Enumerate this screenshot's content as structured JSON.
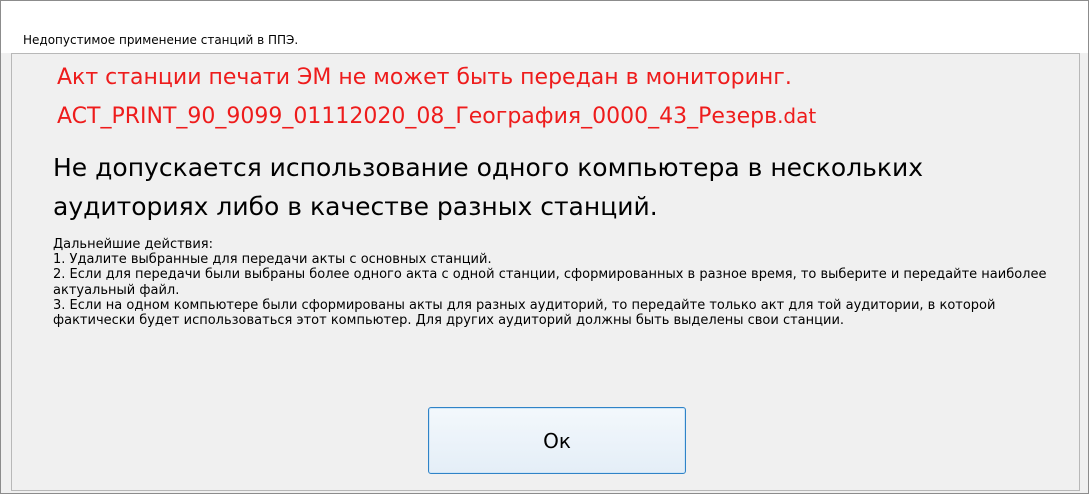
{
  "window": {
    "title": "Недопустимое применение станций в ППЭ."
  },
  "error": {
    "line1": "Акт станции печати ЭМ не может быть передан в мониторинг.",
    "file_name": "ACT_PRINT_90_9099_01112020_08_География_0000_43_Резерв",
    "file_ext": ".dat"
  },
  "headline": {
    "line1": "Не допускается использование одного компьютера в нескольких",
    "line2": "аудиториях либо в качестве разных станций."
  },
  "instructions": {
    "heading": "Дальнейшие действия:",
    "items": [
      "1. Удалите выбранные для передачи акты с основных станций.",
      "2. Если для передачи были выбраны более одного акта с одной станции, сформированных в разное время, то выберите и передайте наиболее актуальный файл.",
      "3. Если на одном компьютере были сформированы акты для разных аудиторий, то передайте только акт для той аудитории, в которой фактически будет использоваться этот компьютер. Для других аудиторий должны быть выделены свои станции."
    ]
  },
  "buttons": {
    "ok_label": "Ок"
  },
  "colors": {
    "error_text": "#ee1c1c",
    "button_border": "#2f83c7",
    "dialog_background": "#f0f0f0"
  }
}
